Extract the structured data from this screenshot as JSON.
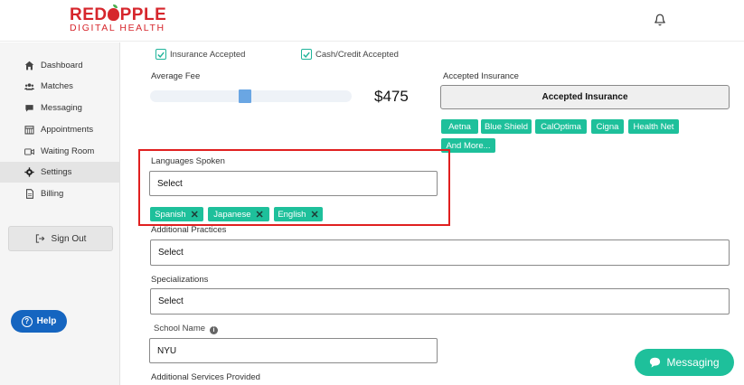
{
  "brand": {
    "name_top_left": "RED",
    "name_top_right": "PPLE",
    "name_bottom": "DIGITAL HEALTH",
    "color": "#d6262c"
  },
  "header": {
    "bell_icon": "bell-icon"
  },
  "sidebar": {
    "items": [
      {
        "label": "Dashboard",
        "icon": "home-icon"
      },
      {
        "label": "Matches",
        "icon": "users-icon"
      },
      {
        "label": "Messaging",
        "icon": "chat-icon"
      },
      {
        "label": "Appointments",
        "icon": "calendar-icon"
      },
      {
        "label": "Waiting Room",
        "icon": "video-icon"
      },
      {
        "label": "Settings",
        "icon": "gear-icon",
        "active": true
      },
      {
        "label": "Billing",
        "icon": "document-icon"
      }
    ],
    "signout_label": "Sign Out",
    "help_label": "Help"
  },
  "form": {
    "insurance_accepted_label": "Insurance Accepted",
    "cash_credit_label": "Cash/Credit Accepted",
    "average_fee_label": "Average Fee",
    "average_fee_value": "$475",
    "average_fee_slider_fraction": 0.47,
    "accepted_insurance_label": "Accepted Insurance",
    "accepted_insurance_button": "Accepted Insurance",
    "insurance_tags": [
      "Aetna",
      "Blue Shield",
      "CalOptima",
      "Cigna",
      "Health Net",
      "And More..."
    ],
    "languages_label": "Languages Spoken",
    "languages_select": "Select",
    "language_tags": [
      "Spanish",
      "Japanese",
      "English"
    ],
    "additional_practices_label": "Additional Practices",
    "additional_practices_select": "Select",
    "specializations_label": "Specializations",
    "specializations_select": "Select",
    "school_name_label": "School Name",
    "school_name_value": "NYU",
    "additional_services_label": "Additional Services Provided"
  },
  "messaging_button": "Messaging",
  "colors": {
    "accent": "#1ec09b",
    "help": "#1565c0",
    "highlight": "#e02020"
  }
}
